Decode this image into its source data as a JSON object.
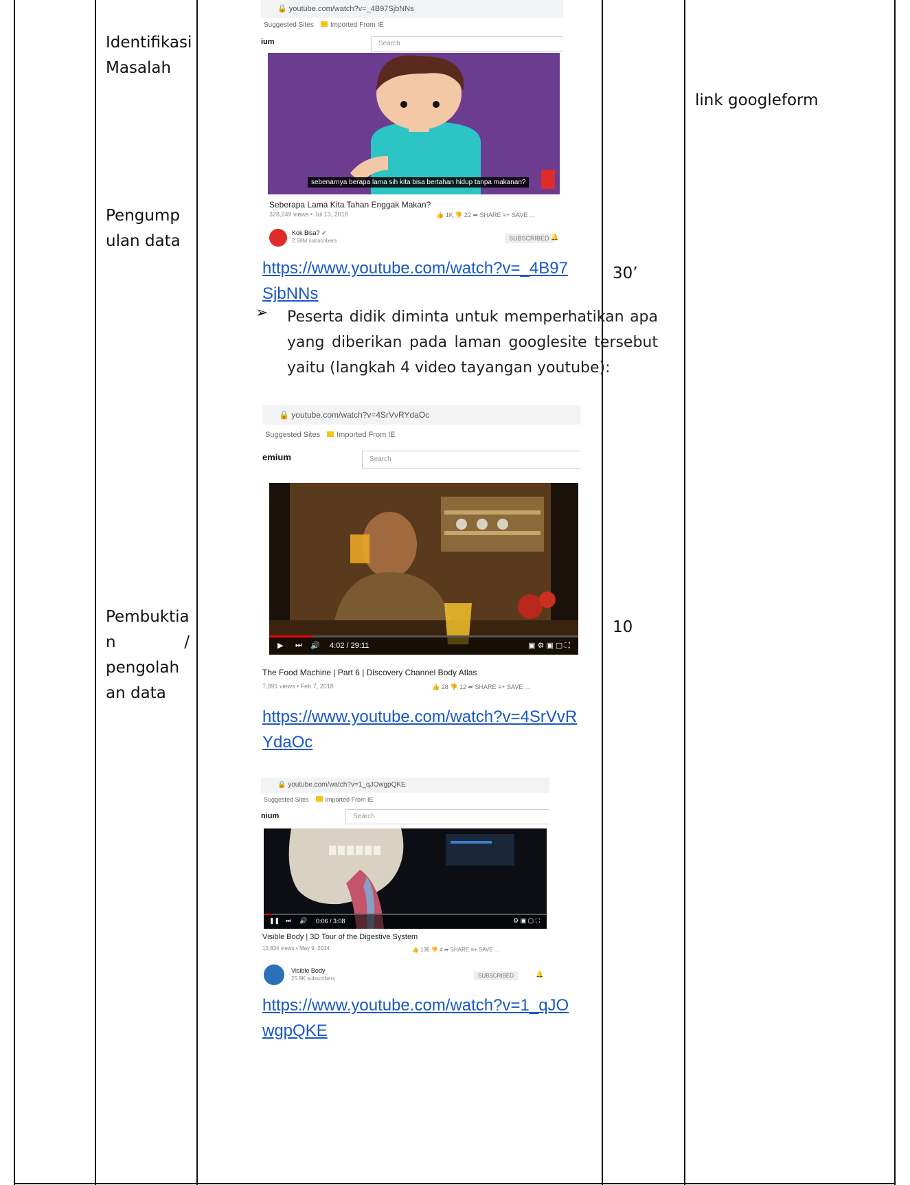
{
  "table": {
    "stages": {
      "identifikasi_line1": "Identifikasi",
      "identifikasi_line2": "Masalah",
      "pengumpulan_line1": "Pengump",
      "pengumpulan_line2": "ulan data",
      "pembuktian_line1": "Pembuktia",
      "pembuktian_line2a": "n",
      "pembuktian_line2b": "/",
      "pembuktian_line3": "pengolah",
      "pembuktian_line4": "an data"
    },
    "times": {
      "t1": "30’",
      "t2": "10"
    },
    "media": {
      "note": "link googleform"
    }
  },
  "activity": {
    "shot1": {
      "url": "youtube.com/watch?v=_4B97SjbNNs",
      "bookmarks_a": "Suggested Sites",
      "bookmarks_b": "Imported From IE",
      "logo": "ium",
      "search": "Search",
      "subtitle": "sebenarnya berapa lama sih kita bisa bertahan hidup tanpa makanan?",
      "title": "Seberapa Lama Kita Tahan Enggak Makan?",
      "meta": "328,249 views • Jul 13, 2018",
      "actions": "👍 1K   👎 22   ➦ SHARE   ≡+ SAVE   ...",
      "channel": "Kok Bisa? ✓",
      "subs": "2.58M subscribers",
      "subscribe": "SUBSCRIBED"
    },
    "link1_line1": "https://www.youtube.com/watch?v=_4B97",
    "link1_line2": "SjbNNs",
    "paragraph": "Peserta didik diminta untuk memperhatikan apa yang diberikan pada laman googlesite tersebut yaitu (langkah 4 video tayangan youtube):",
    "shot2": {
      "url": "youtube.com/watch?v=4SrVvRYdaOc",
      "bookmarks_a": "Suggested Sites",
      "bookmarks_b": "Imported From IE",
      "logo": "emium",
      "search": "Search",
      "time": "4:02 / 29:11",
      "title": "The Food Machine | Part 6 | Discovery Channel Body Atlas",
      "meta": "7,391 views • Feb 7, 2018",
      "actions": "👍 28   👎 12   ➦ SHARE   ≡+ SAVE   ..."
    },
    "link2_line1": "https://www.youtube.com/watch?v=4SrVvR",
    "link2_line2": "YdaOc",
    "shot3": {
      "url": "youtube.com/watch?v=1_qJOwgpQKE",
      "bookmarks_a": "Suggested Sites",
      "bookmarks_b": "Imported From IE",
      "logo": "nium",
      "search": "Search",
      "time": "0:06 / 3:08",
      "title": "Visible Body | 3D Tour of the Digestive System",
      "meta": "13,834 views • May 9, 2014",
      "actions": "👍 136   👎 4   ➦ SHARE   ≡+ SAVE   ...",
      "channel": "Visible Body",
      "subs": "25.9K subscribers",
      "subscribe": "SUBSCRIBED"
    },
    "link3_line1": "https://www.youtube.com/watch?v=1_qJO",
    "link3_line2": "wgpQKE"
  }
}
